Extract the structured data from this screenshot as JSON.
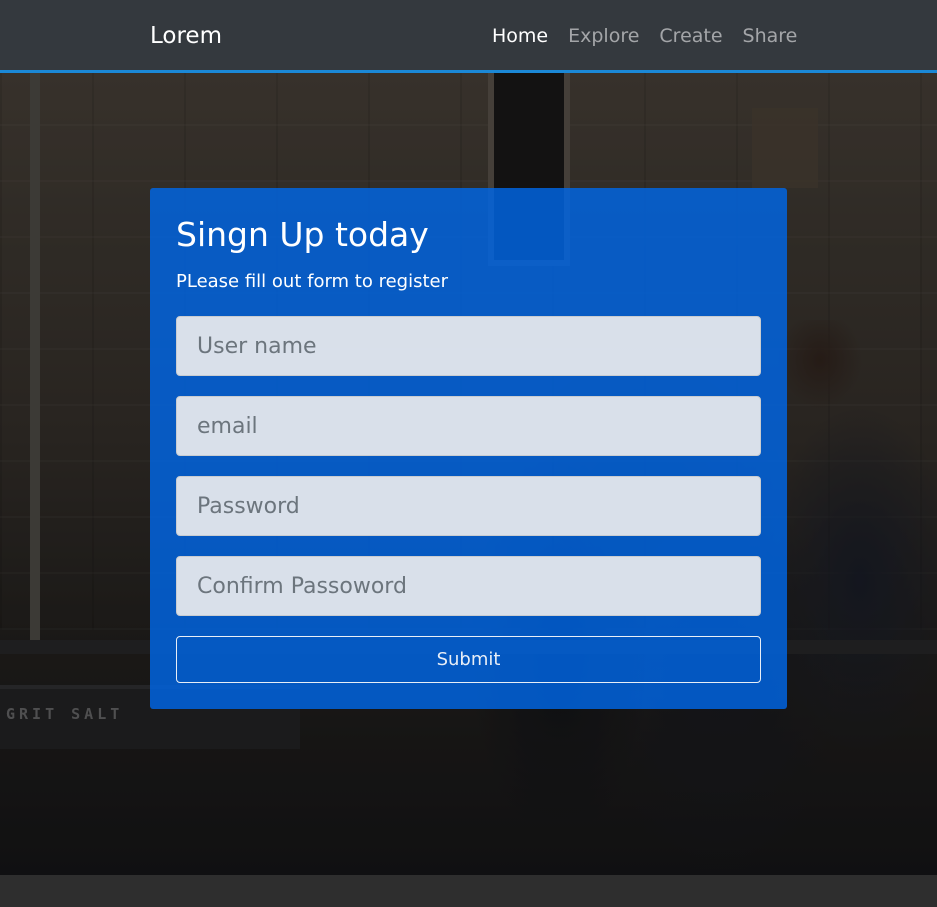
{
  "navbar": {
    "brand": "Lorem",
    "items": [
      {
        "label": "Home",
        "active": true
      },
      {
        "label": "Explore",
        "active": false
      },
      {
        "label": "Create",
        "active": false
      },
      {
        "label": "Share",
        "active": false
      }
    ]
  },
  "background": {
    "sign_text": "GRIT SALT"
  },
  "signup": {
    "title": "Singn Up today",
    "subtitle": "PLease fill out form to register",
    "fields": {
      "username": {
        "placeholder": "User name",
        "value": ""
      },
      "email": {
        "placeholder": "email",
        "value": ""
      },
      "password": {
        "placeholder": "Password",
        "value": ""
      },
      "confirm": {
        "placeholder": "Confirm Passoword",
        "value": ""
      }
    },
    "submit_label": "Submit"
  },
  "colors": {
    "navbar_bg": "#343a40",
    "navbar_border": "#1b88d6",
    "card_bg": "#0066e6",
    "text_light": "#ffffff"
  }
}
